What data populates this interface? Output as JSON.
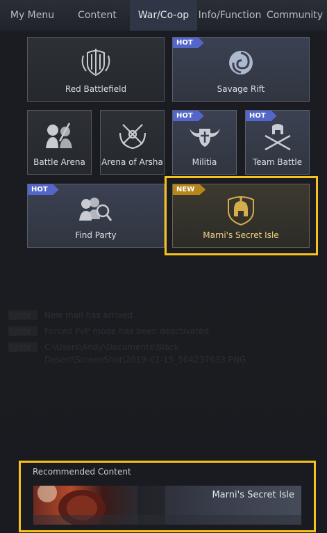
{
  "nav": {
    "tabs": [
      {
        "label": "My Menu"
      },
      {
        "label": "Content"
      },
      {
        "label": "War/Co-op"
      },
      {
        "label": "Info/Function"
      },
      {
        "label": "Community"
      }
    ],
    "active_tab": "War/Co-op"
  },
  "tiles": {
    "red_battlefield": {
      "label": "Red Battlefield",
      "icon": "shield-swords-icon"
    },
    "savage_rift": {
      "label": "Savage Rift",
      "badge": "HOT",
      "icon": "swirl-icon"
    },
    "battle_arena": {
      "label": "Battle Arena",
      "icon": "fighters-icon"
    },
    "arena_of_arsha": {
      "label": "Arena of Arsha",
      "icon": "crossed-swords-wreath-icon"
    },
    "militia": {
      "label": "Militia",
      "badge": "HOT",
      "icon": "winged-shield-axes-icon"
    },
    "team_battle": {
      "label": "Team Battle",
      "badge": "HOT",
      "icon": "helmet-swords-icon"
    },
    "find_party": {
      "label": "Find Party",
      "badge": "HOT",
      "icon": "party-search-icon"
    },
    "marnis_secret_isle": {
      "label": "Marni's Secret Isle",
      "badge": "NEW",
      "icon": "spartan-helmet-shield-icon"
    }
  },
  "log": [
    {
      "tag": "Syste",
      "text": "New mail has arrived"
    },
    {
      "tag": "Syste",
      "text": "Forced PvP mode has been deactivated"
    },
    {
      "tag": "Syste",
      "text": "C:\\Users\\Andy\\Documents\\Black"
    },
    {
      "tag": "",
      "text": "Desert\\ScreenShot\\2019-01-15_504237633.PNG"
    }
  ],
  "recommended": {
    "title": "Recommended Content",
    "banner_label": "Marni's Secret Isle"
  },
  "colors": {
    "highlight": "#f7c21b",
    "hot_badge": "#5466c9",
    "new_badge": "#b8861b"
  }
}
